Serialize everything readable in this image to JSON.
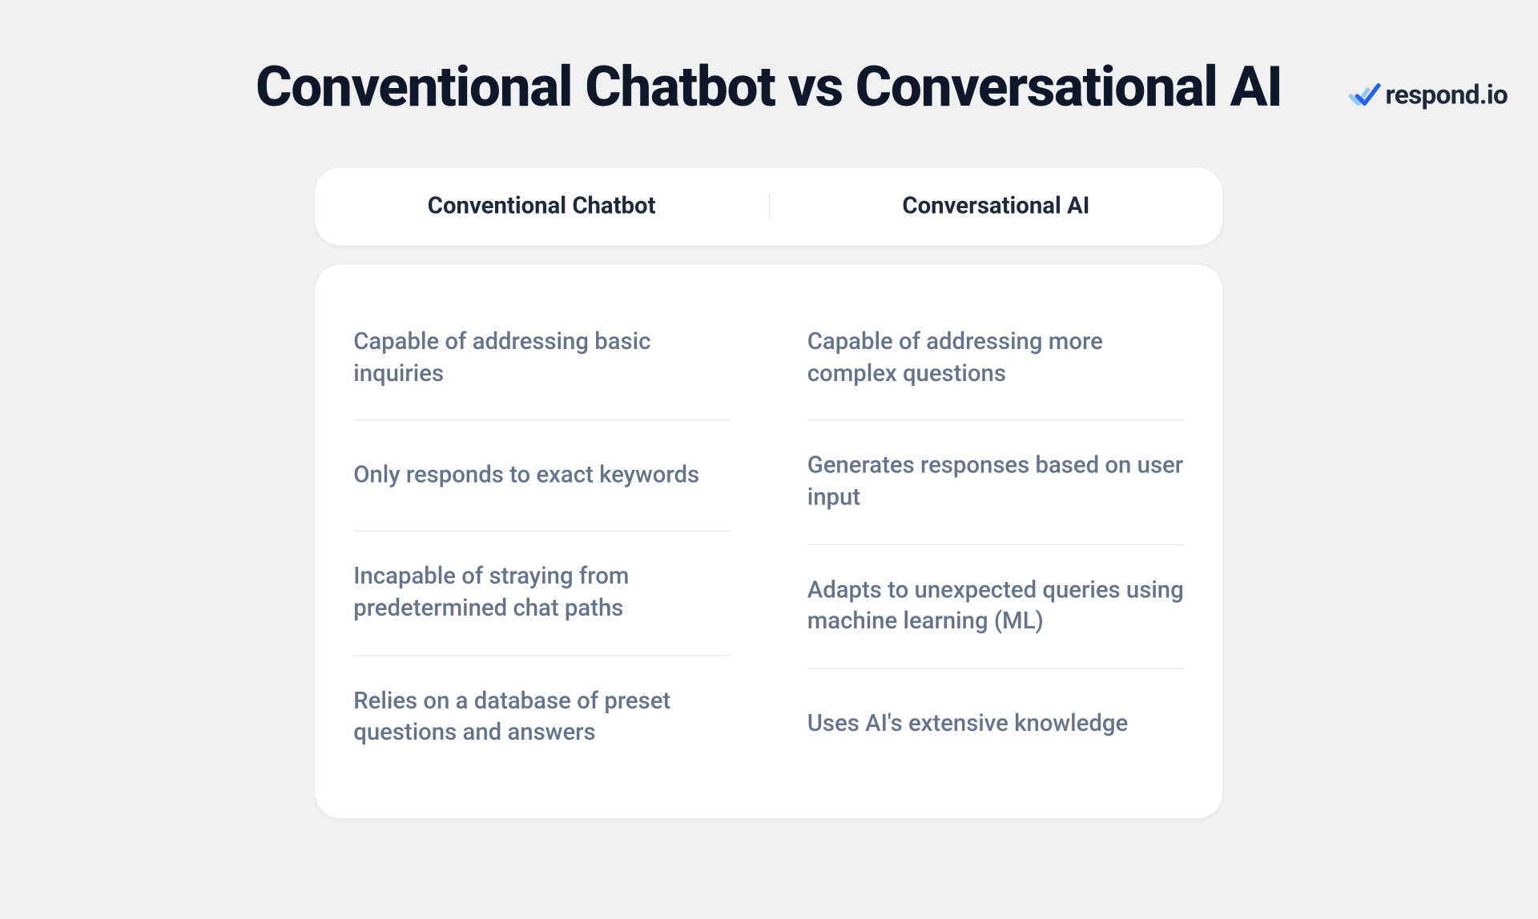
{
  "logo": {
    "text": "respond.io"
  },
  "title": "Conventional Chatbot vs Conversational AI",
  "table": {
    "headers": {
      "left": "Conventional Chatbot",
      "right": "Conversational AI"
    },
    "rows": {
      "left": [
        "Capable of addressing basic inquiries",
        "Only responds to exact keywords",
        "Incapable of straying from predetermined chat paths",
        "Relies on a database of preset questions and answers"
      ],
      "right": [
        "Capable of addressing more complex questions",
        "Generates responses based on user input",
        "Adapts to unexpected queries using machine learning (ML)",
        "Uses AI's extensive knowledge"
      ]
    }
  }
}
